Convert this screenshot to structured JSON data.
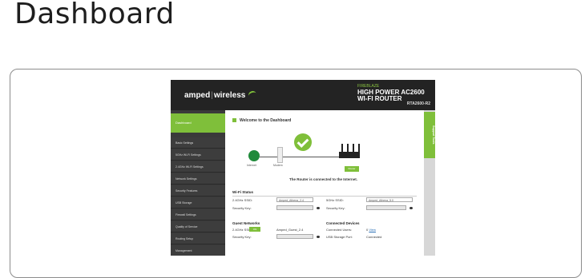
{
  "page": {
    "title": "Dashboard"
  },
  "header": {
    "brand": "amped",
    "brand2": "wireless",
    "product_line1": "FIREBLAZE",
    "product_line2": "HIGH POWER AC2600",
    "product_line3": "WI-FI ROUTER",
    "model": "RTA2600-R2"
  },
  "sidebar": {
    "active": "Dashboard",
    "items": [
      "Basic Settings",
      "5GHz Wi-Fi Settings",
      "2.4GHz Wi-Fi Settings",
      "Network Settings",
      "Security Features",
      "USB Storage",
      "Firewall Settings",
      "Quality of Service",
      "Routing Setup",
      "Management"
    ]
  },
  "right_tab": "Support Tools",
  "main": {
    "welcome": "Welcome to the Dashboard",
    "diagram": {
      "internet_label": "Internet",
      "modem_label": "Modem",
      "router_button": "Router"
    },
    "status_text": "The Router is connected to the Internet.",
    "wifi_status": {
      "title": "Wi-Fi Status",
      "ssid24_label": "2.4GHz SSID:",
      "ssid24_value": "Amped_Athena_2.4",
      "ssid5_label": "5GHz SSID:",
      "ssid5_value": "Amped_Athena_5.0",
      "key_label": "Security Key:",
      "key_label2": "Security Key:"
    },
    "guest": {
      "title": "Guest Networks",
      "ssid_label": "2.4GHz SSID:",
      "toggle": "ON",
      "ssid_value": "Amped_Guest_2.4",
      "key_label": "Security Key:"
    },
    "devices": {
      "title": "Connected Devices",
      "users_label": "Connected Users:",
      "users_value": "0",
      "users_link": "View",
      "usb_label": "USB Storage Port:",
      "usb_value": "Connected"
    }
  }
}
